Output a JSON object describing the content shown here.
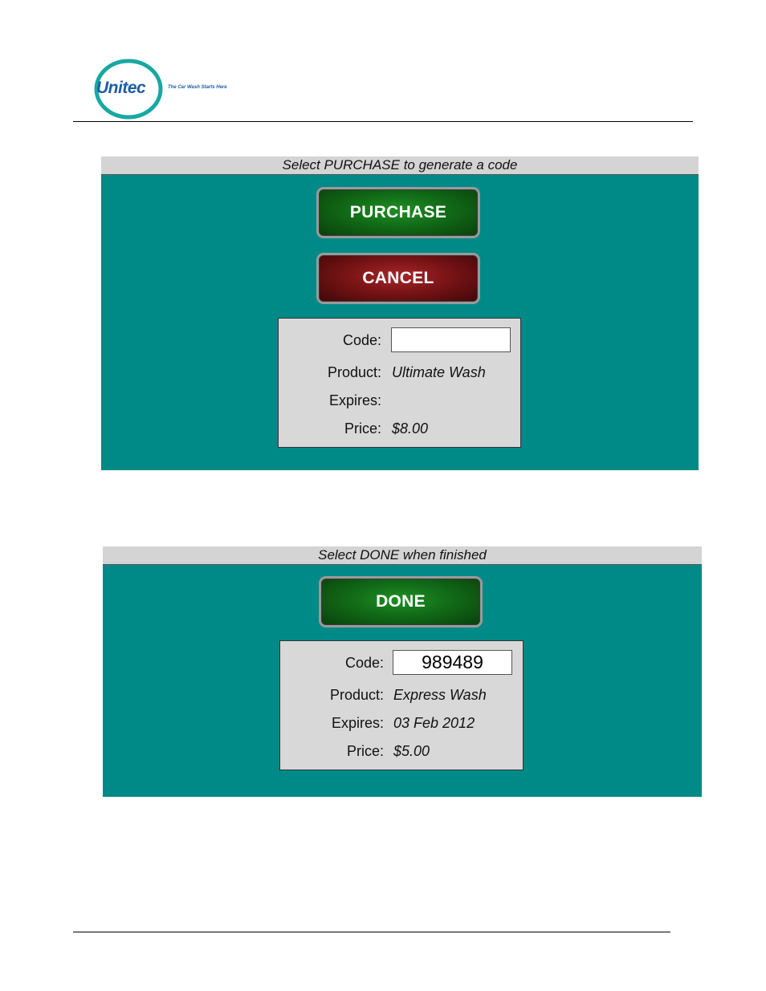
{
  "header": {
    "logo_text": "Unitec",
    "tagline": "The Car Wash Starts Here",
    "brand_color": "#1f5da3",
    "ring_color": "#18a8a3"
  },
  "screen_purchase": {
    "title": "Select PURCHASE to generate a code",
    "purchase_label": "PURCHASE",
    "cancel_label": "CANCEL",
    "fields": {
      "code_label": "Code:",
      "code_value": "",
      "product_label": "Product:",
      "product_value": "Ultimate Wash",
      "expires_label": "Expires:",
      "expires_value": "",
      "price_label": "Price:",
      "price_value": "$8.00"
    }
  },
  "screen_done": {
    "title": "Select DONE when finished",
    "done_label": "DONE",
    "fields": {
      "code_label": "Code:",
      "code_value": "989489",
      "product_label": "Product:",
      "product_value": "Express Wash",
      "expires_label": "Expires:",
      "expires_value": "03 Feb 2012",
      "price_label": "Price:",
      "price_value": "$5.00"
    }
  },
  "colors": {
    "screen_background": "#008a87",
    "title_bar": "#d4d4d4",
    "green_button": "#116b17",
    "red_button": "#7a1416",
    "panel": "#d8d8d8"
  }
}
